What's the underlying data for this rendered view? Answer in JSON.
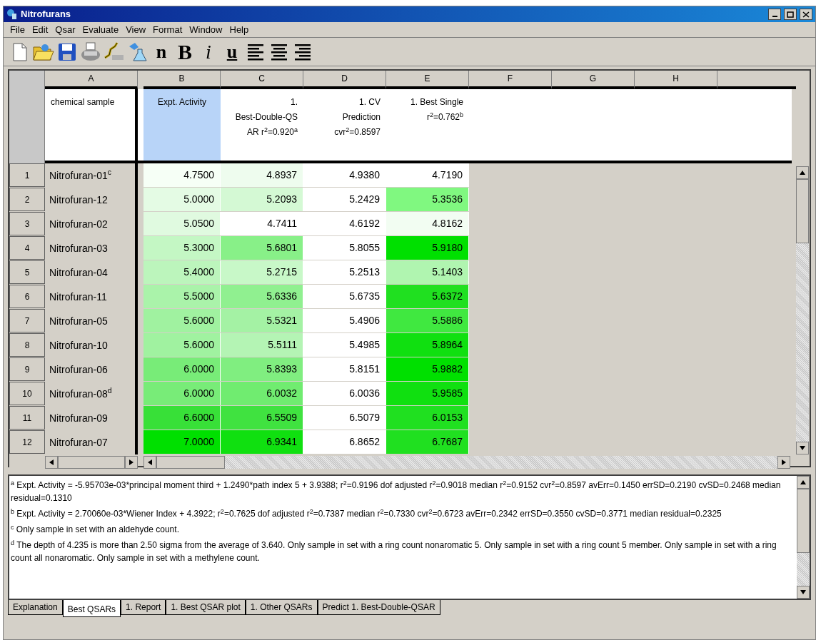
{
  "window": {
    "title": "Nitrofurans"
  },
  "menu": [
    "File",
    "Edit",
    "Qsar",
    "Evaluate",
    "View",
    "Format",
    "Window",
    "Help"
  ],
  "toolbar": [
    {
      "kind": "new"
    },
    {
      "kind": "open"
    },
    {
      "kind": "save"
    },
    {
      "kind": "print"
    },
    {
      "kind": "qsar"
    },
    {
      "kind": "flask"
    },
    {
      "kind": "text",
      "label": "n"
    },
    {
      "kind": "bold",
      "label": "B"
    },
    {
      "kind": "italic",
      "label": "i"
    },
    {
      "kind": "underline",
      "label": "u"
    },
    {
      "kind": "align-left"
    },
    {
      "kind": "align-center"
    },
    {
      "kind": "align-right"
    }
  ],
  "columns": [
    "A",
    "B",
    "C",
    "D",
    "E",
    "F",
    "G",
    "H"
  ],
  "headers": [
    {
      "lines": [
        "chemical sample"
      ],
      "selected": false
    },
    {
      "lines": [
        "Expt. Activity"
      ],
      "selected": true
    },
    {
      "lines": [
        "1.",
        "Best-Double-QS",
        "AR r$^{2}$=0.920$^{a}$"
      ],
      "selected": false
    },
    {
      "lines": [
        "1. CV",
        "Prediction",
        "cvr$^{2}$=0.8597"
      ],
      "selected": false
    },
    {
      "lines": [
        "1. Best Single",
        "r$^{2}$=0.762$^{b}$"
      ],
      "selected": false
    }
  ],
  "rows": [
    {
      "num": "1",
      "sample": "Nitrofuran-01$^{c}$",
      "cells": [
        {
          "text": "4.7500",
          "color": "#f6fff6"
        },
        {
          "text": "4.8937",
          "color": "#eefcee"
        },
        {
          "text": "4.9380"
        },
        {
          "text": "4.7190"
        }
      ]
    },
    {
      "num": "2",
      "sample": "Nitrofuran-12",
      "cells": [
        {
          "text": "5.0000",
          "color": "#e4fbe4"
        },
        {
          "text": "5.2093",
          "color": "#d4f9d4"
        },
        {
          "text": "5.2429"
        },
        {
          "text": "5.3536",
          "color": "#80f880"
        }
      ]
    },
    {
      "num": "3",
      "sample": "Nitrofuran-02",
      "cells": [
        {
          "text": "5.0500",
          "color": "#e0fae0"
        },
        {
          "text": "4.7411"
        },
        {
          "text": "4.6192"
        },
        {
          "text": "4.8162",
          "color": "#f2fdf2"
        }
      ]
    },
    {
      "num": "4",
      "sample": "Nitrofuran-03",
      "cells": [
        {
          "text": "5.3000",
          "color": "#c4f7c4"
        },
        {
          "text": "5.6801",
          "color": "#88f088"
        },
        {
          "text": "5.8055"
        },
        {
          "text": "5.9180",
          "color": "#00e000"
        }
      ]
    },
    {
      "num": "5",
      "sample": "Nitrofuran-04",
      "cells": [
        {
          "text": "5.4000",
          "color": "#bcf5bc"
        },
        {
          "text": "5.2715",
          "color": "#c8f8c8"
        },
        {
          "text": "5.2513"
        },
        {
          "text": "5.1403",
          "color": "#b0f5b0"
        }
      ]
    },
    {
      "num": "6",
      "sample": "Nitrofuran-11",
      "cells": [
        {
          "text": "5.5000",
          "color": "#aaf3aa"
        },
        {
          "text": "5.6336",
          "color": "#90f090"
        },
        {
          "text": "5.6735"
        },
        {
          "text": "5.6372",
          "color": "#20e020"
        }
      ]
    },
    {
      "num": "7",
      "sample": "Nitrofuran-05",
      "cells": [
        {
          "text": "5.6000",
          "color": "#a0f2a0"
        },
        {
          "text": "5.5321",
          "color": "#a4f2a4"
        },
        {
          "text": "5.4906"
        },
        {
          "text": "5.5886",
          "color": "#40e840"
        }
      ]
    },
    {
      "num": "8",
      "sample": "Nitrofuran-10",
      "cells": [
        {
          "text": "5.6000",
          "color": "#a0f2a0"
        },
        {
          "text": "5.5111",
          "color": "#b4f4b4"
        },
        {
          "text": "5.4985"
        },
        {
          "text": "5.8964",
          "color": "#10e010"
        }
      ]
    },
    {
      "num": "9",
      "sample": "Nitrofuran-06",
      "cells": [
        {
          "text": "6.0000",
          "color": "#78ec78"
        },
        {
          "text": "5.8393",
          "color": "#80ee80"
        },
        {
          "text": "5.8151"
        },
        {
          "text": "5.9882",
          "color": "#00e000"
        }
      ]
    },
    {
      "num": "10",
      "sample": "Nitrofuran-08$^{d}$",
      "cells": [
        {
          "text": "6.0000",
          "color": "#78ec78"
        },
        {
          "text": "6.0032",
          "color": "#70ec70"
        },
        {
          "text": "6.0036"
        },
        {
          "text": "5.9585",
          "color": "#10e010"
        }
      ]
    },
    {
      "num": "11",
      "sample": "Nitrofuran-09",
      "cells": [
        {
          "text": "6.6000",
          "color": "#38e038"
        },
        {
          "text": "6.5509",
          "color": "#40e240"
        },
        {
          "text": "6.5079"
        },
        {
          "text": "6.0153",
          "color": "#20e020"
        }
      ]
    },
    {
      "num": "12",
      "sample": "Nitrofuran-07",
      "cells": [
        {
          "text": "7.0000",
          "color": "#00e000"
        },
        {
          "text": "6.9341",
          "color": "#10e010"
        },
        {
          "text": "6.8652"
        },
        {
          "text": "6.7687",
          "color": "#20e020"
        }
      ]
    }
  ],
  "notes": [
    "$^{a}$ Expt. Activity = -5.95703e-03*principal moment third + 1.2490*path index 5 + 3.9388; r$^{2}$=0.9196 dof adjusted r$^{2}$=0.9018 median r$^{2}$=0.9152 cvr$^{2}$=0.8597 avErr=0.1450 errSD=0.2190 cvSD=0.2468 median residual=0.1310",
    "$^{b}$ Expt. Activity = 2.70060e-03*Wiener Index + 4.3922; r$^{2}$=0.7625 dof adjusted r$^{2}$=0.7387 median r$^{2}$=0.7330 cvr$^{2}$=0.6723 avErr=0.2342 errSD=0.3550 cvSD=0.3771 median residual=0.2325",
    "$^{c}$ Only sample in set with an aldehyde count.",
    "$^{d}$  The depth of 4.235 is more than 2.50 sigma from the average of 3.640. Only sample in set with a ring count nonaromatic 5. Only sample in set with a ring count 5 member. Only sample in set with a ring count all nonaromatic. Only sample in set with a methylene count."
  ],
  "tabs": [
    {
      "label": "Explanation",
      "selected": false
    },
    {
      "label": "Best QSARs",
      "selected": true
    },
    {
      "label": "1. Report",
      "selected": false
    },
    {
      "label": "1. Best QSAR plot",
      "selected": false
    },
    {
      "label": "1. Other QSARs",
      "selected": false
    },
    {
      "label": "Predict 1. Best-Double-QSAR",
      "selected": false
    }
  ]
}
